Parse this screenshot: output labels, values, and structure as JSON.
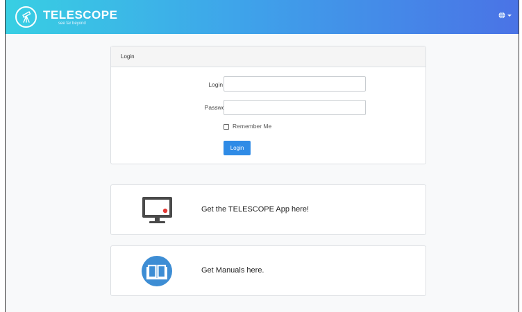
{
  "header": {
    "brand_name": "TELESCOPE",
    "tagline": "see far beyond"
  },
  "login": {
    "header_title": "Login",
    "login_id_label": "Login ID",
    "login_id_value": "",
    "password_label": "Password",
    "password_value": "",
    "remember_label": "Remember Me",
    "remember_checked": false,
    "button_label": "Login"
  },
  "promos": {
    "app_text": "Get the TELESCOPE App here!",
    "manual_text": "Get Manuals here."
  },
  "icons": {
    "logo": "telescope-icon",
    "language": "globe-icon",
    "app": "monitor-icon",
    "manual": "book-icon"
  },
  "colors": {
    "header_gradient_start": "#38cfe3",
    "header_gradient_end": "#4a73e6",
    "primary_button": "#2f8be6",
    "book_icon": "#3d8dd4",
    "monitor_dot": "#e53935"
  }
}
